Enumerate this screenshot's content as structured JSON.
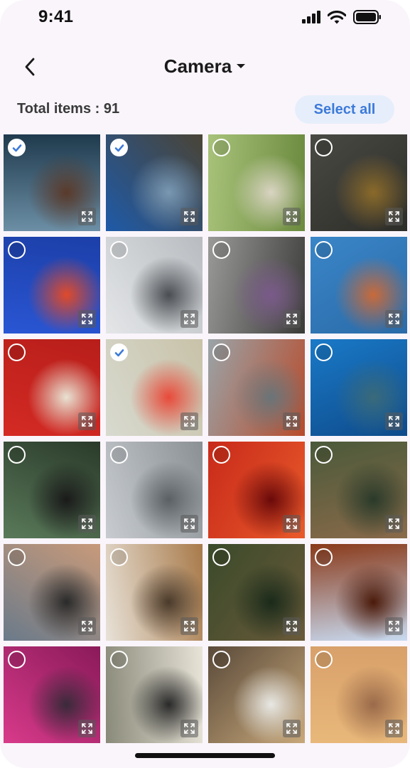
{
  "status_bar": {
    "time": "9:41",
    "icons": [
      "cellular-signal-icon",
      "wifi-icon",
      "battery-icon"
    ]
  },
  "header": {
    "title": "Camera",
    "back_icon": "chevron-left-icon",
    "title_icon": "caret-down-icon"
  },
  "toolbar": {
    "total_label": "Total items : 91",
    "select_all_label": "Select all",
    "select_all_color": "#3c7ad9",
    "select_all_background": "#e6eefb"
  },
  "photos": [
    {
      "name": "photo-diver-reef",
      "selected": true,
      "colors": [
        "#6c8fa6",
        "#1f3a4d",
        "#5a3a2a"
      ]
    },
    {
      "name": "photo-coastal-rock",
      "selected": true,
      "colors": [
        "#1e5aa8",
        "#4a4436",
        "#7a98b2"
      ]
    },
    {
      "name": "photo-couple-path",
      "selected": false,
      "colors": [
        "#a8c27a",
        "#6b8a3e",
        "#d9d4c2"
      ]
    },
    {
      "name": "photo-pouring-bowl",
      "selected": false,
      "colors": [
        "#4a4a44",
        "#2c2c28",
        "#8a6a2a"
      ]
    },
    {
      "name": "photo-blue-balls",
      "selected": false,
      "colors": [
        "#2a56d4",
        "#1c3fa8",
        "#e04a2a"
      ]
    },
    {
      "name": "photo-sports-car",
      "selected": false,
      "colors": [
        "#e4e6e8",
        "#b8bcc0",
        "#4a4e52"
      ]
    },
    {
      "name": "photo-laptop-friends",
      "selected": false,
      "colors": [
        "#9a9a98",
        "#3a3a38",
        "#7a5a8a"
      ]
    },
    {
      "name": "photo-dancer-sky",
      "selected": false,
      "colors": [
        "#3a86c8",
        "#2a6aa8",
        "#c86a3a"
      ]
    },
    {
      "name": "photo-red-switches",
      "selected": false,
      "colors": [
        "#d42a24",
        "#b81e1a",
        "#e8e2d2"
      ]
    },
    {
      "name": "photo-birthday-cake",
      "selected": true,
      "colors": [
        "#d8dad0",
        "#c8c2a8",
        "#e84a3a"
      ]
    },
    {
      "name": "photo-red-bridge",
      "selected": false,
      "colors": [
        "#9aa4a8",
        "#b84a2a",
        "#6a7478"
      ]
    },
    {
      "name": "photo-ocean-diver",
      "selected": false,
      "colors": [
        "#1a7ac8",
        "#0e4a8a",
        "#3a6a7a"
      ]
    },
    {
      "name": "photo-portrait-woman",
      "selected": false,
      "colors": [
        "#5a7a5a",
        "#2a3a2a",
        "#1a1a1a"
      ]
    },
    {
      "name": "photo-apartment-tower",
      "selected": false,
      "colors": [
        "#c8ccd0",
        "#8a9094",
        "#5a6064"
      ]
    },
    {
      "name": "photo-red-abstract",
      "selected": false,
      "colors": [
        "#c82a1a",
        "#e85a2a",
        "#6a0a0a"
      ]
    },
    {
      "name": "photo-forest-camp",
      "selected": false,
      "colors": [
        "#4a5a3a",
        "#8a6a4a",
        "#2a3a2a"
      ]
    },
    {
      "name": "photo-smiling-woman",
      "selected": false,
      "colors": [
        "#6a7a8a",
        "#c89a7a",
        "#2a2a2a"
      ]
    },
    {
      "name": "photo-tea-tools",
      "selected": false,
      "colors": [
        "#e8e2d8",
        "#a87a4a",
        "#4a3a2a"
      ]
    },
    {
      "name": "photo-forest-cabin",
      "selected": false,
      "colors": [
        "#3a4a2a",
        "#6a5a3a",
        "#1a2a1a"
      ]
    },
    {
      "name": "photo-rock-arch",
      "selected": false,
      "colors": [
        "#8a3a1a",
        "#c8daf0",
        "#4a1a0a"
      ]
    },
    {
      "name": "photo-runners-hug",
      "selected": false,
      "colors": [
        "#d83a8a",
        "#8a1a5a",
        "#3a2a3a"
      ]
    },
    {
      "name": "photo-puffin",
      "selected": false,
      "colors": [
        "#8a8a7a",
        "#e8e4d8",
        "#2a2a2a"
      ]
    },
    {
      "name": "photo-food-table",
      "selected": false,
      "colors": [
        "#5a4a3a",
        "#c8a87a",
        "#e8e8e4"
      ]
    },
    {
      "name": "photo-sunset-haze",
      "selected": false,
      "colors": [
        "#e8b87a",
        "#d8a06a",
        "#9a6a4a"
      ]
    }
  ],
  "colors": {
    "background": "#faf5fb",
    "title": "#1a1a1a",
    "check": "#3c7ad9"
  }
}
